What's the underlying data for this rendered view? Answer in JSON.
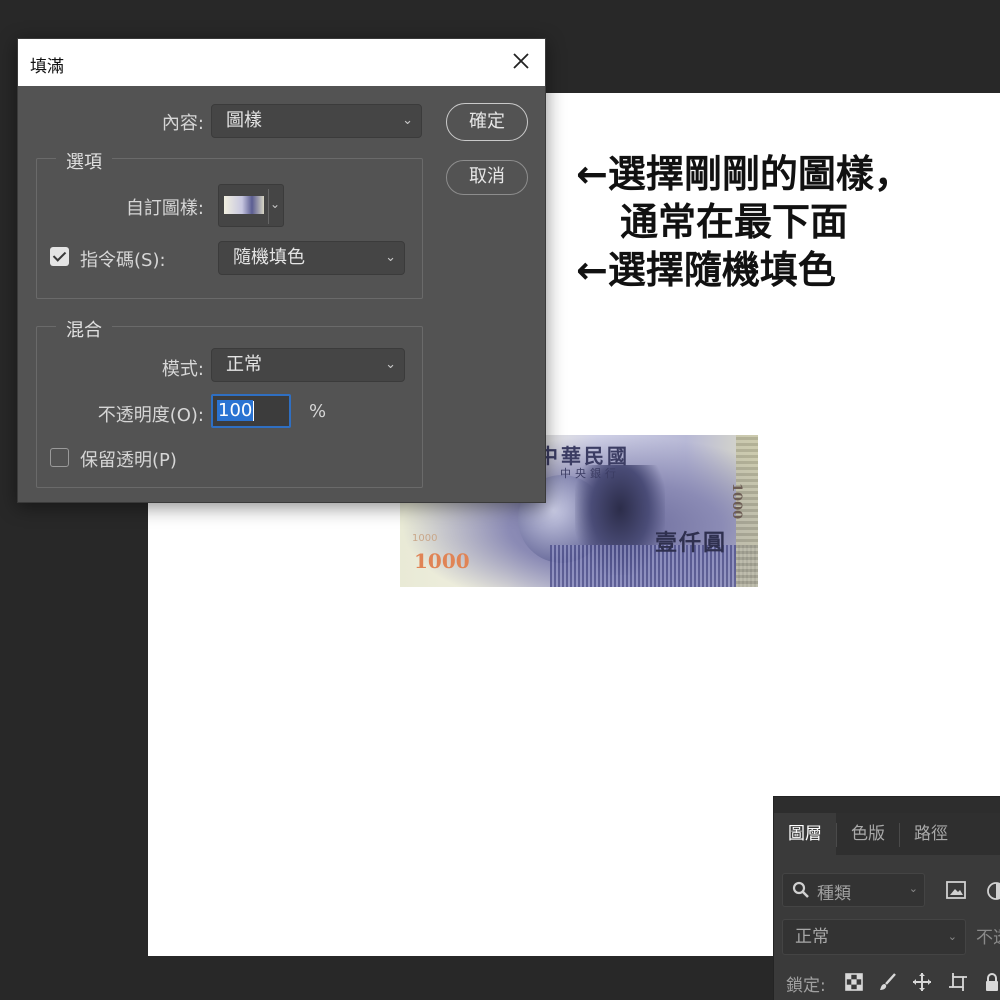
{
  "annotations": {
    "line1": "←選擇剛剛的圖樣，",
    "line2": "通常在最下面",
    "line3": "←選擇隨機填色"
  },
  "banknote": {
    "country": "中華民國",
    "bank": "中央銀行",
    "denomination_text": "壹仟圓",
    "number": "1000"
  },
  "dialog": {
    "title": "填滿",
    "contents_label": "內容:",
    "contents_value": "圖樣",
    "ok_label": "確定",
    "cancel_label": "取消",
    "options_group": "選項",
    "custom_pattern_label": "自訂圖樣:",
    "script_label": "指令碼(S):",
    "script_checked": true,
    "script_value": "隨機填色",
    "blending_group": "混合",
    "mode_label": "模式:",
    "mode_value": "正常",
    "opacity_label": "不透明度(O):",
    "opacity_value": "100",
    "opacity_unit": "%",
    "preserve_label": "保留透明(P)",
    "preserve_checked": false
  },
  "layers_panel": {
    "tabs": [
      "圖層",
      "色版",
      "路徑"
    ],
    "active_tab": "圖層",
    "filter_placeholder": "種類",
    "blend_mode": "正常",
    "opacity_label": "不透",
    "lock_label": "鎖定:"
  }
}
